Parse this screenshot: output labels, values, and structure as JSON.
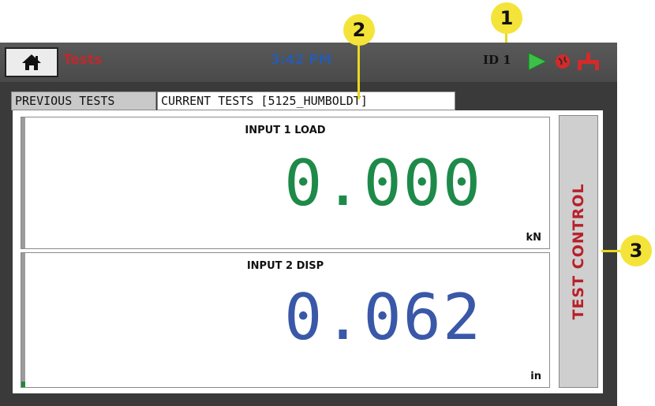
{
  "topbar": {
    "app_title": "Tests",
    "time": "3:42 PM",
    "id_label": "ID 1",
    "icons": [
      "home-icon",
      "play-icon",
      "globe-icon",
      "network-icon"
    ]
  },
  "tabs": [
    {
      "label": "PREVIOUS TESTS",
      "selected": false
    },
    {
      "label": "CURRENT TESTS [5125_HUMBOLDT]",
      "selected": true
    }
  ],
  "inputs": [
    {
      "title": "INPUT 1 LOAD",
      "value": "0.000",
      "unit": "kN",
      "color": "#1e8a4a",
      "level": 0
    },
    {
      "title": "INPUT 2 DISP",
      "value": "0.062",
      "unit": "in",
      "color": "#3a58a8",
      "level": 0.04
    }
  ],
  "test_control_label": "TEST CONTROL",
  "callouts": [
    "1",
    "2",
    "3"
  ],
  "colors": {
    "accent_red": "#c0282e",
    "clock_blue": "#2a5ba8",
    "callout_yellow": "#f4e43a"
  }
}
